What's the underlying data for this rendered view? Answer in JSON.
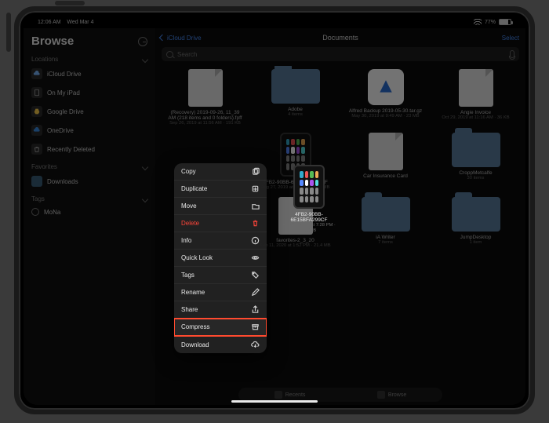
{
  "status": {
    "time": "12:06 AM",
    "date": "Wed Mar 4",
    "battery_pct": "77%"
  },
  "sidebar": {
    "title": "Browse",
    "groups": {
      "locations_label": "Locations",
      "favorites_label": "Favorites",
      "tags_label": "Tags"
    },
    "locations": [
      {
        "label": "iCloud Drive"
      },
      {
        "label": "On My iPad"
      },
      {
        "label": "Google Drive"
      },
      {
        "label": "OneDrive"
      },
      {
        "label": "Recently Deleted"
      }
    ],
    "favorites": [
      {
        "label": "Downloads"
      }
    ],
    "tags": [
      {
        "label": "MoNa"
      }
    ]
  },
  "header": {
    "back_label": "iCloud Drive",
    "title": "Documents",
    "select_label": "Select"
  },
  "search": {
    "placeholder": "Search"
  },
  "files": [
    {
      "name": "(Recovery) 2019-09-26, 11_39 AM (218 items and 0 folders).fpff",
      "sub": "Sep 26, 2019 at 11:56 AM · 191 KB",
      "kind": "page"
    },
    {
      "name": "Adobe",
      "sub": "4 items",
      "kind": "folder"
    },
    {
      "name": "Alfred Backup 2019-05-30.tar.gz",
      "sub": "May 30, 2019 at 9:49 AM · 23 MB",
      "kind": "appicon"
    },
    {
      "name": "Angie Invoice",
      "sub": "Oct 29, 2019 at 11:16 AM · 36 KB",
      "kind": "page"
    },
    {
      "name": "",
      "sub": "",
      "kind": "blank"
    },
    {
      "name": "4FB2-90BB-6E15BFA299CF",
      "sub": "Aug 27, 2019 at 7:28 PM · 2.5 MB",
      "kind": "ipad"
    },
    {
      "name": "Car Insurance Card",
      "sub": "",
      "kind": "page"
    },
    {
      "name": "CroppMetcalfe",
      "sub": "30 items",
      "kind": "folder"
    },
    {
      "name": "",
      "sub": "",
      "kind": "blank"
    },
    {
      "name": "favorites-2_3_20",
      "sub": "Feb 11, 2020 at 1:52 PM · 21.4 MB",
      "kind": "page"
    },
    {
      "name": "iA Writer",
      "sub": "7 items",
      "kind": "folder"
    },
    {
      "name": "JumpDesktop",
      "sub": "1 item",
      "kind": "folder"
    }
  ],
  "selected_file": {
    "name": "4FB2-90BB-6E15BFA299CF",
    "sub": "Aug 27, 2019 at 7:28 PM · 2.5 MB"
  },
  "context_menu": [
    {
      "label": "Copy",
      "icon": "copy",
      "destructive": false
    },
    {
      "label": "Duplicate",
      "icon": "duplicate",
      "destructive": false
    },
    {
      "label": "Move",
      "icon": "move",
      "destructive": false
    },
    {
      "label": "Delete",
      "icon": "trash",
      "destructive": true
    },
    {
      "label": "Info",
      "icon": "info",
      "destructive": false
    },
    {
      "label": "Quick Look",
      "icon": "eye",
      "destructive": false
    },
    {
      "label": "Tags",
      "icon": "tag",
      "destructive": false
    },
    {
      "label": "Rename",
      "icon": "pencil",
      "destructive": false
    },
    {
      "label": "Share",
      "icon": "share",
      "destructive": false
    },
    {
      "label": "Compress",
      "icon": "archive",
      "destructive": false,
      "highlighted": true
    },
    {
      "label": "Download",
      "icon": "download",
      "destructive": false
    }
  ],
  "dock": {
    "recents_label": "Recents",
    "browse_label": "Browse"
  }
}
